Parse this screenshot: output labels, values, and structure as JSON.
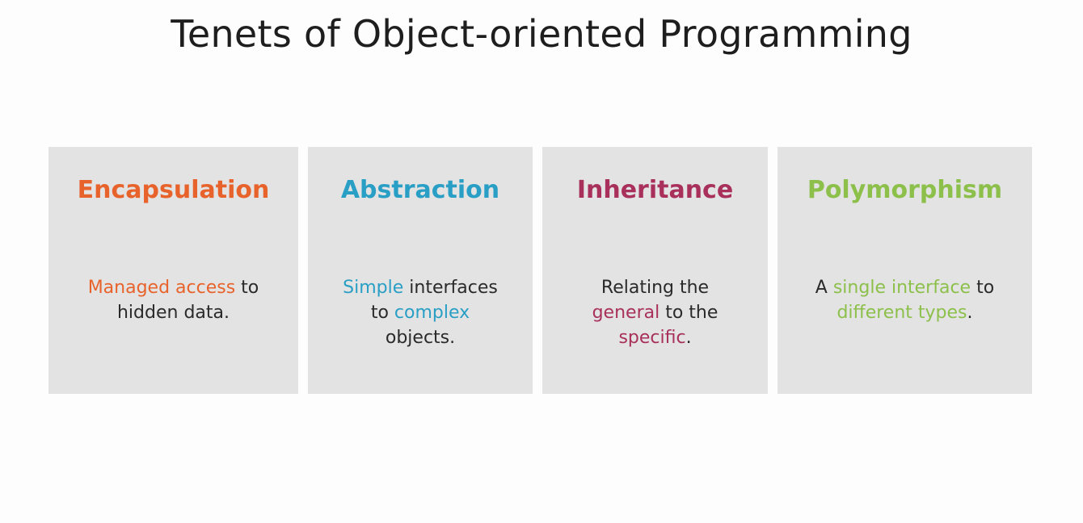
{
  "title": "Tenets of Object-oriented Programming",
  "colors": {
    "encapsulation": "#e8632b",
    "abstraction": "#2a9fc6",
    "inheritance": "#a8305a",
    "polymorphism": "#8cc04b",
    "card_background": "#e3e3e3"
  },
  "cards": [
    {
      "heading": "Encapsulation",
      "lines": [
        [
          {
            "text": "Managed access",
            "accent": true
          },
          {
            "text": " to",
            "accent": false
          }
        ],
        [
          {
            "text": "hidden data.",
            "accent": false
          }
        ]
      ]
    },
    {
      "heading": "Abstraction",
      "lines": [
        [
          {
            "text": "Simple",
            "accent": true
          },
          {
            "text": " interfaces",
            "accent": false
          }
        ],
        [
          {
            "text": "to ",
            "accent": false
          },
          {
            "text": "complex",
            "accent": true
          }
        ],
        [
          {
            "text": "objects.",
            "accent": false
          }
        ]
      ]
    },
    {
      "heading": "Inheritance",
      "lines": [
        [
          {
            "text": "Relating the",
            "accent": false
          }
        ],
        [
          {
            "text": "general",
            "accent": true
          },
          {
            "text": " to the",
            "accent": false
          }
        ],
        [
          {
            "text": "specific",
            "accent": true
          },
          {
            "text": ".",
            "accent": false
          }
        ]
      ]
    },
    {
      "heading": "Polymorphism",
      "lines": [
        [
          {
            "text": "A ",
            "accent": false
          },
          {
            "text": "single interface",
            "accent": true
          },
          {
            "text": " to",
            "accent": false
          }
        ],
        [
          {
            "text": "different types",
            "accent": true
          },
          {
            "text": ".",
            "accent": false
          }
        ]
      ]
    }
  ]
}
